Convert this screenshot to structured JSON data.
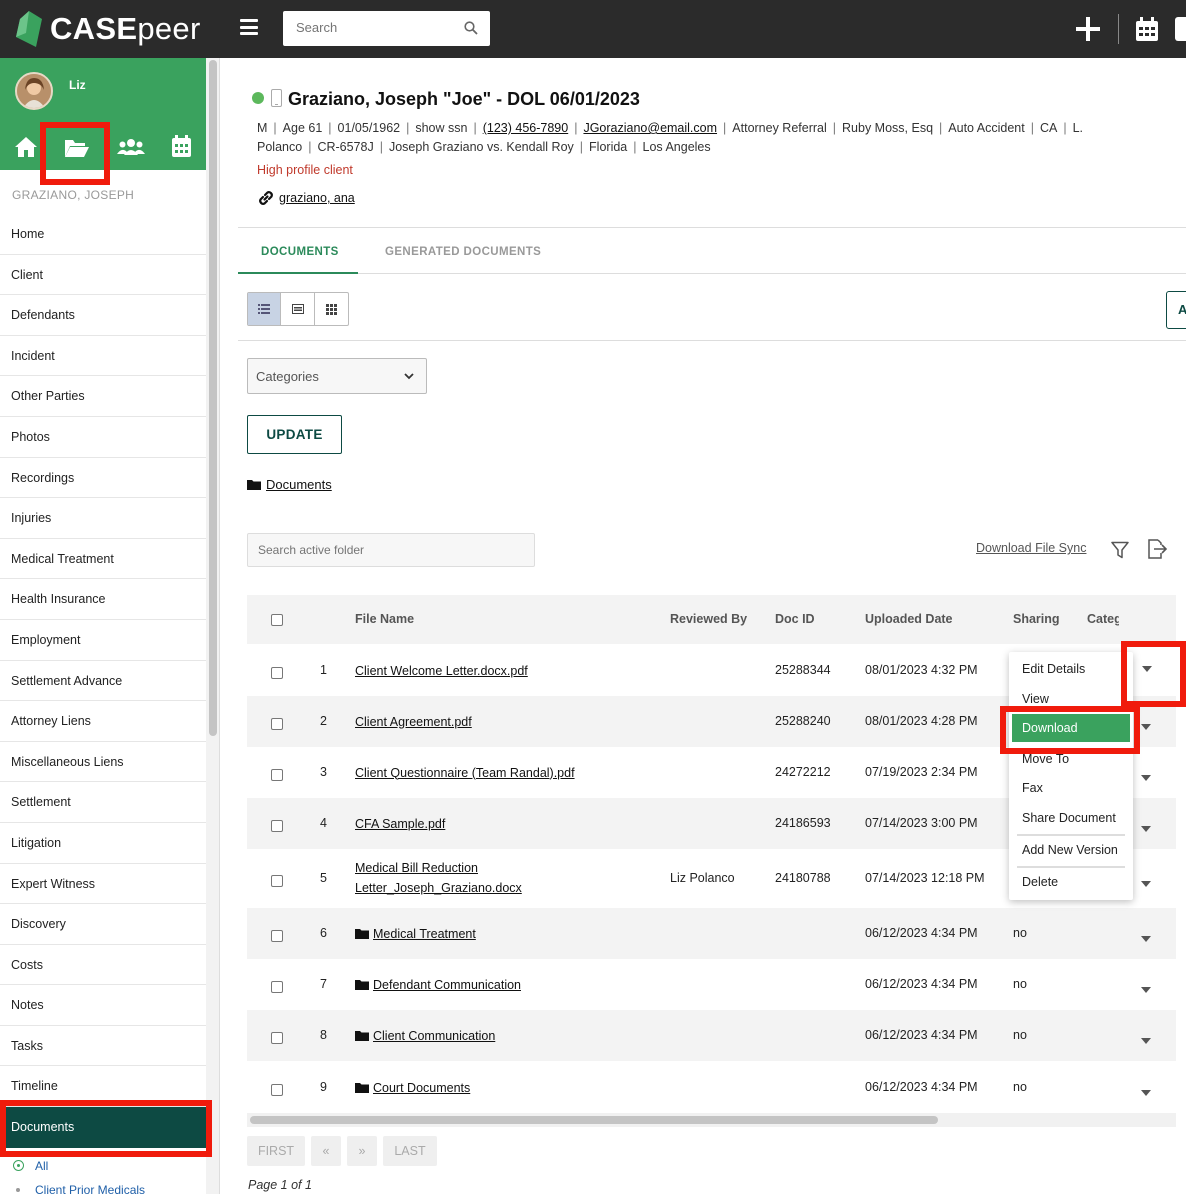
{
  "app": {
    "brand_bold": "CASE",
    "brand_rest": "peer"
  },
  "topbar": {
    "search_placeholder": "Search"
  },
  "user": {
    "name": "Liz"
  },
  "case_label": "GRAZIANO, JOSEPH",
  "nav": [
    "Home",
    "Client",
    "Defendants",
    "Incident",
    "Other Parties",
    "Photos",
    "Recordings",
    "Injuries",
    "Medical Treatment",
    "Health Insurance",
    "Employment",
    "Settlement Advance",
    "Attorney Liens",
    "Miscellaneous Liens",
    "Settlement",
    "Litigation",
    "Expert Witness",
    "Discovery",
    "Costs",
    "Notes",
    "Tasks",
    "Timeline",
    "Documents"
  ],
  "subnav": [
    "All",
    "Client Prior Medicals"
  ],
  "client": {
    "title": "Graziano, Joseph \"Joe\" - DOL 06/01/2023",
    "gender": "M",
    "age": "Age 61",
    "dob": "01/05/1962",
    "ssn": "show ssn",
    "phone": "(123) 456-7890",
    "email": "JGoraziano@email.com",
    "referral": "Attorney Referral",
    "attorney": "Ruby Moss, Esq",
    "case_type": "Auto Accident",
    "state": "CA",
    "staff": "L. Polanco",
    "case_no": "CR-6578J",
    "caption": "Joseph Graziano vs. Kendall Roy",
    "venue": "Florida",
    "county": "Los Angeles",
    "flag": "High profile client",
    "linked": "graziano, ana"
  },
  "tabs": [
    "DOCUMENTS",
    "GENERATED DOCUMENTS"
  ],
  "right_btn": "A",
  "categories_label": "Categories",
  "update_label": "UPDATE",
  "breadcrumb": "Documents",
  "folder_search_placeholder": "Search active folder",
  "download_sync": "Download File Sync",
  "table": {
    "headers": {
      "file": "File Name",
      "reviewed": "Reviewed By",
      "docid": "Doc ID",
      "uploaded": "Uploaded Date",
      "sharing": "Sharing",
      "category": "Categ"
    },
    "rows": [
      {
        "n": "1",
        "name": "Client Welcome Letter.docx.pdf",
        "reviewed": "",
        "docid": "25288344",
        "date": "08/01/2023 4:32 PM",
        "sharing": "",
        "folder": false
      },
      {
        "n": "2",
        "name": "Client Agreement.pdf",
        "reviewed": "",
        "docid": "25288240",
        "date": "08/01/2023 4:28 PM",
        "sharing": "",
        "folder": false
      },
      {
        "n": "3",
        "name": "Client Questionnaire (Team Randal).pdf",
        "reviewed": "",
        "docid": "24272212",
        "date": "07/19/2023 2:34 PM",
        "sharing": "",
        "folder": false
      },
      {
        "n": "4",
        "name": "CFA Sample.pdf",
        "reviewed": "",
        "docid": "24186593",
        "date": "07/14/2023 3:00 PM",
        "sharing": "",
        "folder": false
      },
      {
        "n": "5",
        "name": "Medical Bill Reduction Letter_Joseph_Graziano.docx",
        "reviewed": "Liz Polanco",
        "docid": "24180788",
        "date": "07/14/2023 12:18 PM",
        "sharing": "",
        "folder": false
      },
      {
        "n": "6",
        "name": "Medical Treatment",
        "reviewed": "",
        "docid": "",
        "date": "06/12/2023 4:34 PM",
        "sharing": "no",
        "folder": true
      },
      {
        "n": "7",
        "name": "Defendant Communication",
        "reviewed": "",
        "docid": "",
        "date": "06/12/2023 4:34 PM",
        "sharing": "no",
        "folder": true
      },
      {
        "n": "8",
        "name": "Client Communication",
        "reviewed": "",
        "docid": "",
        "date": "06/12/2023 4:34 PM",
        "sharing": "no",
        "folder": true
      },
      {
        "n": "9",
        "name": "Court Documents",
        "reviewed": "",
        "docid": "",
        "date": "06/12/2023 4:34 PM",
        "sharing": "no",
        "folder": true
      }
    ]
  },
  "menu": [
    "Edit Details",
    "View",
    "Download",
    "Move To",
    "Fax",
    "Share Document",
    "Add New Version",
    "Delete"
  ],
  "pager": {
    "first": "FIRST",
    "prev": "«",
    "next": "»",
    "last": "LAST",
    "info": "Page 1 of 1"
  },
  "colors": {
    "brand_green": "#3aa25e",
    "dark_teal": "#0d4a43",
    "highlight_red": "#f01b0c",
    "topbar": "#2b2b2b"
  }
}
